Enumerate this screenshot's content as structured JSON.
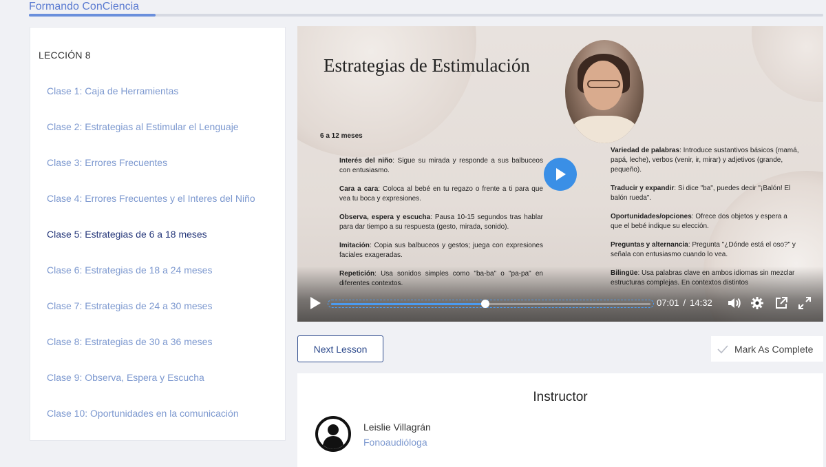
{
  "brand": {
    "title": "Formando ConCiencia"
  },
  "sidebar": {
    "lesson_title": "LECCIÓN 8",
    "active_index": 4,
    "items": [
      {
        "label": "Clase 1: Caja de Herramientas"
      },
      {
        "label": "Clase 2: Estrategias al Estimular el Lenguaje"
      },
      {
        "label": "Clase 3: Errores Frecuentes"
      },
      {
        "label": "Clase 4: Errores Frecuentes y el Interes del Niño"
      },
      {
        "label": "Clase 5: Estrategias de 6 a 18 meses"
      },
      {
        "label": "Clase 6: Estrategias de 18 a 24 meses"
      },
      {
        "label": "Clase 7: Estrategias de 24 a 30 meses"
      },
      {
        "label": "Clase 8: Estrategias de 30 a 36 meses"
      },
      {
        "label": "Clase 9: Observa, Espera y Escucha"
      },
      {
        "label": "Clase 10: Oportunidades en la comunicación"
      }
    ]
  },
  "video": {
    "slide": {
      "title": "Estrategias de Estimulación",
      "age": "6 a 12 meses",
      "left": [
        {
          "head": "Interés del niño",
          "text": ": Sigue su mirada y responde a sus balbuceos con entusiasmo."
        },
        {
          "head": "Cara a cara",
          "text": ": Coloca al bebé en tu regazo o frente a ti para que vea tu boca y expresiones."
        },
        {
          "head": "Observa, espera y escucha",
          "text": ": Pausa 10-15 segundos tras hablar para dar tiempo a su respuesta (gesto, mirada, sonido)."
        },
        {
          "head": "Imitación",
          "text": ": Copia sus balbuceos y gestos; juega con expresiones faciales exageradas."
        },
        {
          "head": "Repetición",
          "text": ": Usa sonidos simples como \"ba-ba\" o \"pa-pa\" en diferentes contextos."
        }
      ],
      "right": [
        {
          "head": "Variedad de palabras",
          "text": ": Introduce sustantivos básicos (mamá, papá, leche), verbos (venir, ir, mirar) y adjetivos (grande, pequeño)."
        },
        {
          "head": "Traducir y expandir",
          "text": ": Si dice \"ba\", puedes decir \"¡Balón! El balón rueda\"."
        },
        {
          "head": "Oportunidades/opciones",
          "text": ": Ofrece dos objetos y espera a que el bebé indique su elección."
        },
        {
          "head": "Preguntas y alternancia",
          "text": ": Pregunta \"¿Dónde está el oso?\" y señala con entusiasmo cuando lo vea."
        },
        {
          "head": "Bilingüe",
          "text": ": Usa palabras clave en ambos idiomas sin mezclar estructuras complejas. En contextos distintos"
        }
      ]
    },
    "current_time": "07:01",
    "separator": "/",
    "duration": "14:32",
    "progress_fraction": 0.4827,
    "accent_color": "#3a8fe6"
  },
  "actions": {
    "next_label": "Next Lesson",
    "complete_label": "Mark As Complete"
  },
  "instructor": {
    "heading": "Instructor",
    "name": "Leislie Villagrán",
    "role": "Fonoaudióloga"
  },
  "icons": {
    "play": "play-icon",
    "volume": "volume-icon",
    "settings": "gear-icon",
    "popout": "popout-icon",
    "fullscreen": "fullscreen-icon",
    "check": "check-icon",
    "avatar": "user-avatar-icon"
  }
}
